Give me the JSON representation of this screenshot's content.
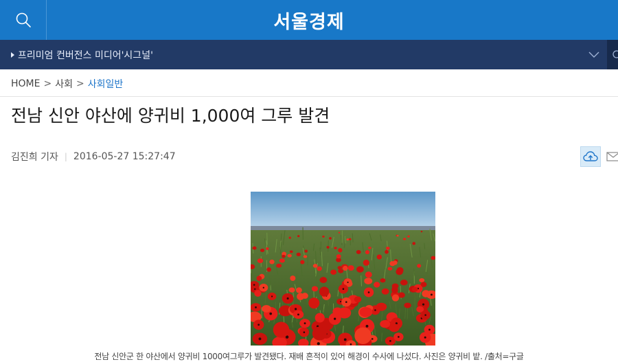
{
  "header": {
    "brand": "서울경제",
    "search_icon": "search-icon",
    "bg_color": "#1878c8"
  },
  "subnav": {
    "label": "프리미엄 컨버전스 미디어'시그널'",
    "chevron_icon": "chevron-down-icon",
    "bg_color": "#223a66"
  },
  "breadcrumb": {
    "home": "HOME",
    "sep1": ">",
    "section": "사회",
    "sep2": ">",
    "current": "사회일반"
  },
  "article": {
    "title": "전남 신안 야산에 양귀비 1,000여 그루 발견",
    "author": "김진희 기자",
    "separator": "|",
    "datetime": "2016-05-27 15:27:47",
    "photo_caption": "전남 신안군 한 야산에서 양귀비 1000여그루가 발견됐다. 재배 흔적이 있어 해경이 수사에 나섰다. 사진은 양귀비 밭. /출처=구글"
  },
  "actions": {
    "cloud_icon": "cloud-upload-icon",
    "mail_icon": "mail-icon"
  },
  "colors": {
    "accent_link": "#1d74c9"
  }
}
